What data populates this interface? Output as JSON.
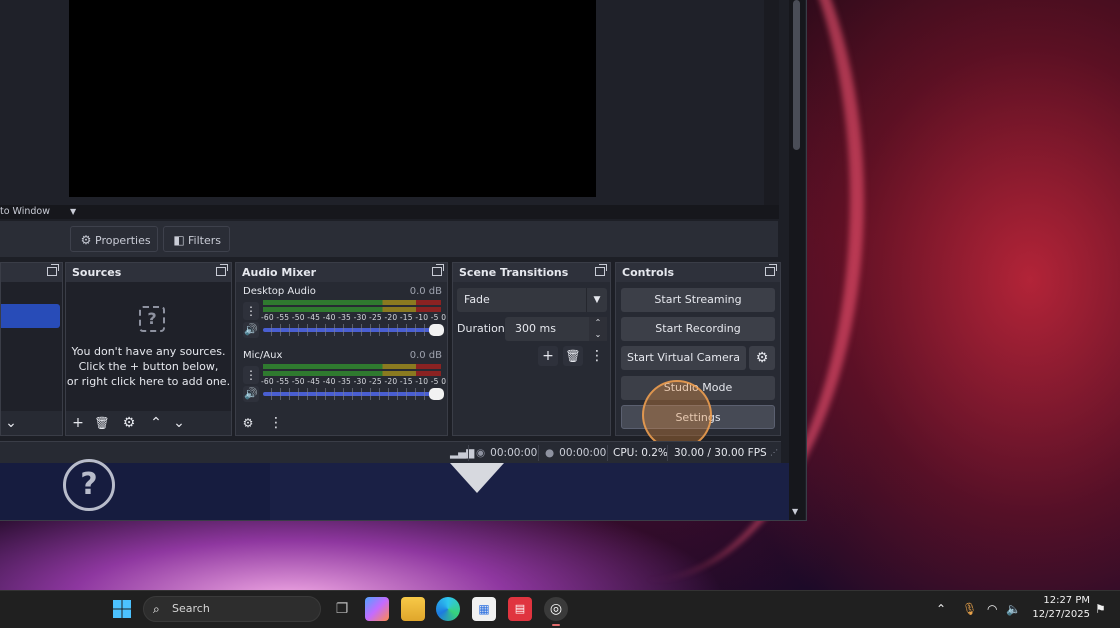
{
  "preview": {
    "fit_label": "to Window"
  },
  "toolbar": {
    "properties_label": "Properties",
    "filters_label": "Filters"
  },
  "docks": {
    "sources": {
      "title": "Sources",
      "empty_line1": "You don't have any sources.",
      "empty_line2": "Click the + button below,",
      "empty_line3": "or right click here to add one."
    },
    "audio_mixer": {
      "title": "Audio Mixer",
      "channels": [
        {
          "name": "Desktop Audio",
          "db": "0.0 dB"
        },
        {
          "name": "Mic/Aux",
          "db": "0.0 dB"
        }
      ],
      "meter_ticks": "-60 -55 -50 -45 -40 -35 -30 -25 -20 -15 -10 -5 0"
    },
    "scene_transitions": {
      "title": "Scene Transitions",
      "transition": "Fade",
      "duration_label": "Duration",
      "duration_value": "300 ms"
    },
    "controls": {
      "title": "Controls",
      "start_streaming": "Start Streaming",
      "start_recording": "Start Recording",
      "start_virtual_camera": "Start Virtual Camera",
      "studio_mode": "Studio Mode",
      "settings": "Settings"
    }
  },
  "status": {
    "stream_time": "00:00:00",
    "record_time": "00:00:00",
    "cpu": "CPU: 0.2%",
    "fps": "30.00 / 30.00 FPS"
  },
  "taskbar": {
    "search_placeholder": "Search",
    "time": "12:27 PM",
    "date": "12/27/2025"
  },
  "icons": {
    "start": "windows-logo-icon",
    "task_view": "task-view-icon",
    "copilot": "copilot-icon",
    "explorer": "file-explorer-icon",
    "edge": "edge-icon",
    "store": "store-icon",
    "app_red": "app-icon",
    "obs": "obs-icon"
  },
  "colors": {
    "accent_blue": "#284cb8",
    "meter_green": "#2f7a2f",
    "meter_yellow": "#8a7a20",
    "meter_red": "#8a2222"
  }
}
